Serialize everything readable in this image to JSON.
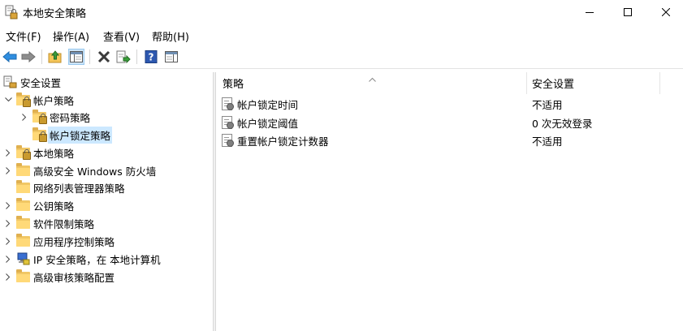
{
  "window": {
    "title": "本地安全策略"
  },
  "menu": [
    "文件(F)",
    "操作(A)",
    "查看(V)",
    "帮助(H)"
  ],
  "toolbar": {
    "buttons": [
      "back-arrow-icon",
      "forward-arrow-icon",
      "up-folder-icon",
      "show-hide-tree-icon",
      "delete-icon",
      "export-list-icon",
      "help-icon",
      "show-action-pane-icon"
    ]
  },
  "tree": {
    "root": "安全设置",
    "account_policies": "帐户策略",
    "password_policy": "密码策略",
    "lockout_policy": "帐户锁定策略",
    "local_policies": "本地策略",
    "firewall": "高级安全 Windows 防火墙",
    "network_list": "网络列表管理器策略",
    "public_key": "公钥策略",
    "software_restriction": "软件限制策略",
    "app_control": "应用程序控制策略",
    "ipsec": "IP 安全策略，在 本地计算机",
    "audit": "高级审核策略配置"
  },
  "list": {
    "columns": [
      "策略",
      "安全设置"
    ],
    "rows": [
      {
        "policy": "帐户锁定时间",
        "setting": "不适用"
      },
      {
        "policy": "帐户锁定阈值",
        "setting": "0 次无效登录"
      },
      {
        "policy": "重置帐户锁定计数器",
        "setting": "不适用"
      }
    ]
  },
  "colors": {
    "selection": "#cce8ff",
    "folder": "#ffd978",
    "toolbar_active": "#cce4f7"
  }
}
